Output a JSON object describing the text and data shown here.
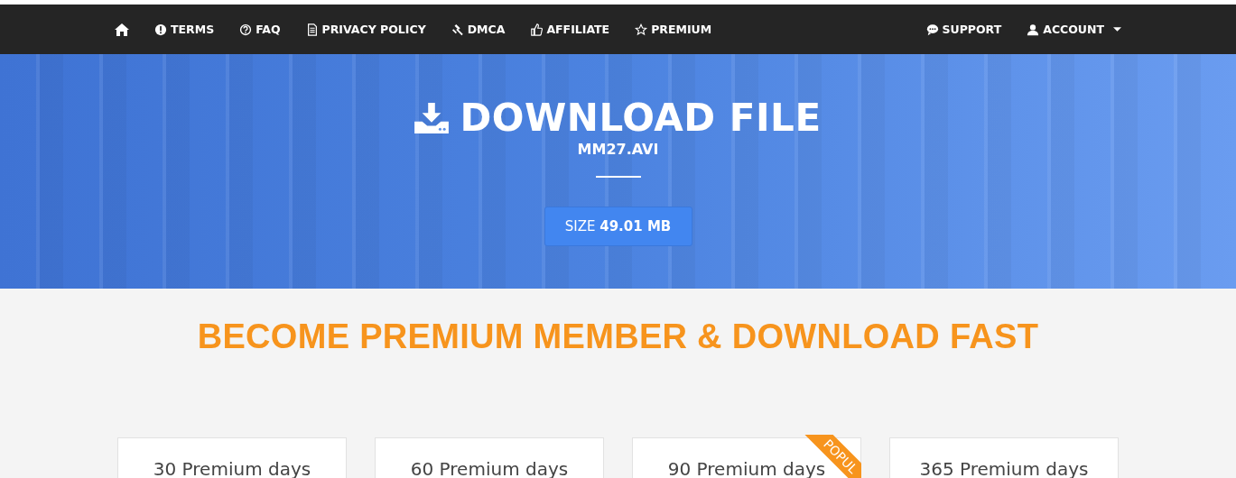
{
  "nav": {
    "left": [
      {
        "label": "TERMS"
      },
      {
        "label": "FAQ"
      },
      {
        "label": "PRIVACY POLICY"
      },
      {
        "label": "DMCA"
      },
      {
        "label": "AFFILIATE"
      },
      {
        "label": "PREMIUM"
      }
    ],
    "right": [
      {
        "label": "SUPPORT",
        "dropdown": false
      },
      {
        "label": "ACCOUNT",
        "dropdown": true
      }
    ]
  },
  "hero": {
    "title": "DOWNLOAD FILE",
    "filename": "MM27.AVI",
    "size_label": "SIZE",
    "size_value": "49.01 MB"
  },
  "premium": {
    "heading": "BECOME PREMIUM MEMBER & DOWNLOAD FAST",
    "plans": [
      {
        "title": "30 Premium days"
      },
      {
        "title": "60 Premium days"
      },
      {
        "title": "90 Premium days",
        "ribbon": "POPUL"
      },
      {
        "title": "365 Premium days"
      }
    ]
  }
}
